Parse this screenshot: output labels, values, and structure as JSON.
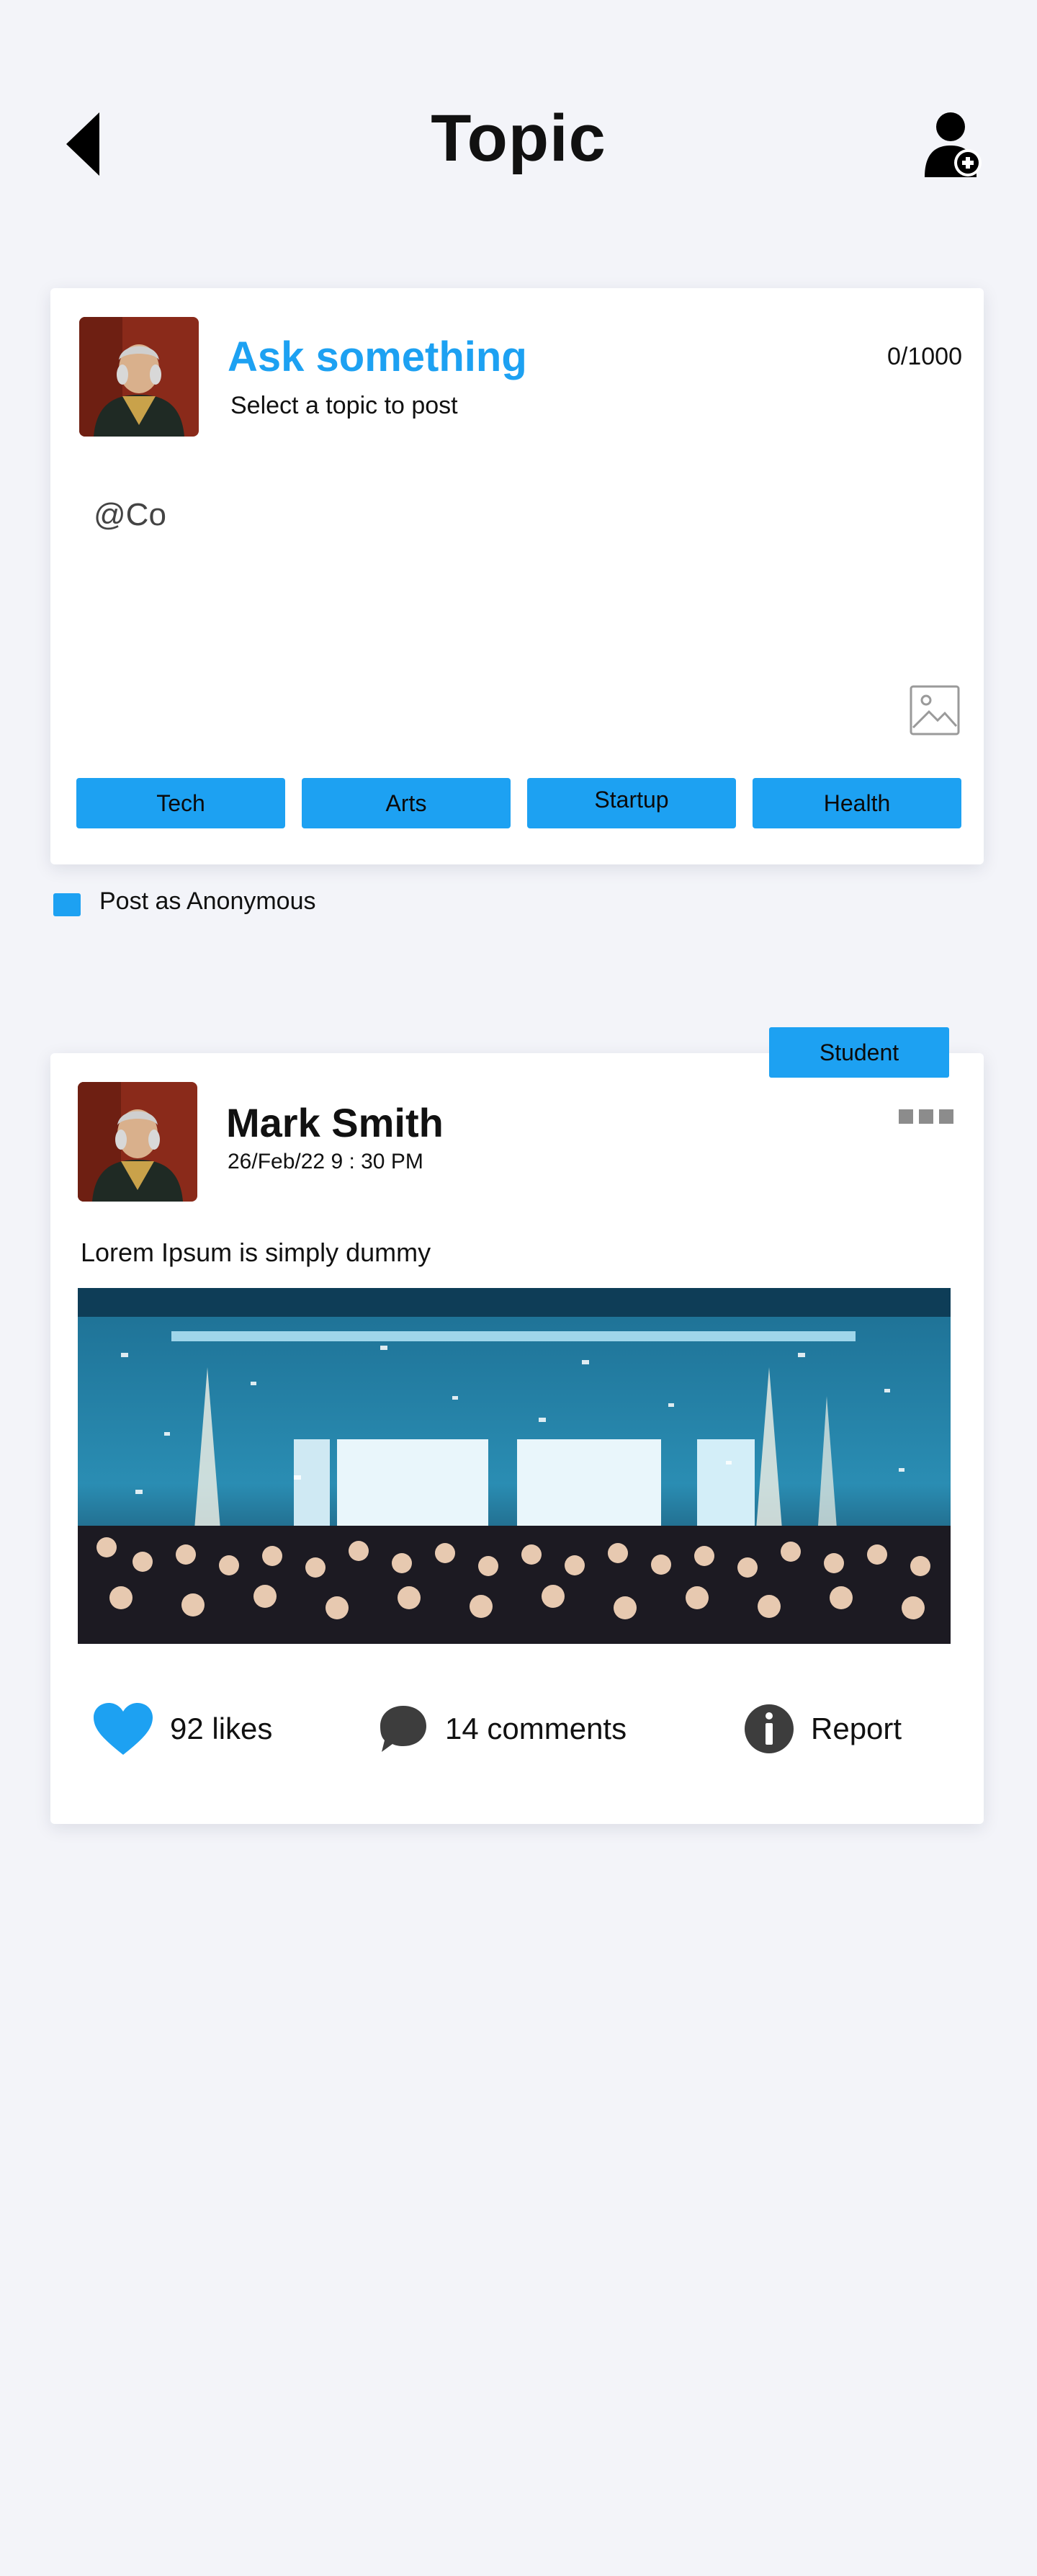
{
  "header": {
    "title": "Topic",
    "back_icon": "back-arrow-icon",
    "add_user_icon": "add-user-icon"
  },
  "composer": {
    "title": "Ask something",
    "subtitle": "Select a topic to post",
    "char_count": "0/1000",
    "input_value": "@Co",
    "image_icon": "image-icon",
    "topics": [
      "Tech",
      "Arts",
      "Startup",
      "Health"
    ]
  },
  "anonymous": {
    "label": "Post as Anonymous",
    "checked": true
  },
  "post": {
    "badge": "Student",
    "author": "Mark Smith",
    "date": "26/Feb/22  9 : 30 PM",
    "text": "Lorem Ipsum is simply dummy",
    "likes": "92 likes",
    "comments": "14 comments",
    "report": "Report"
  },
  "colors": {
    "accent": "#1da1f2",
    "background": "#f3f4f9",
    "icon_dark": "#3d3d3d"
  }
}
